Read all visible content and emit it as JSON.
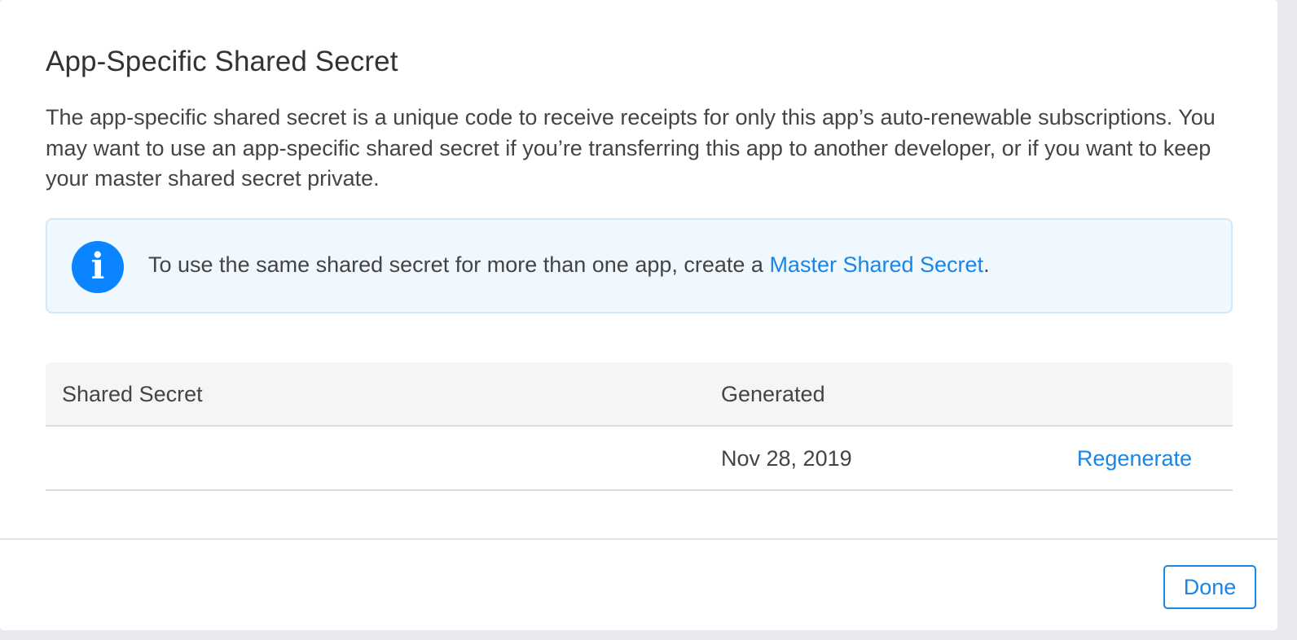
{
  "dialog": {
    "title": "App-Specific Shared Secret",
    "description": "The app-specific shared secret is a unique code to receive receipts for only this app’s auto-renewable subscriptions. You may want to use an app-specific shared secret if you’re transferring this app to another developer, or if you want to keep your master shared secret private."
  },
  "info": {
    "icon": "info-icon",
    "icon_glyph": "i",
    "text_before": "To use the same shared secret for more than one app, create a ",
    "link_label": "Master Shared Secret",
    "text_after": "."
  },
  "table": {
    "columns": [
      "Shared Secret",
      "Generated"
    ],
    "rows": [
      {
        "shared_secret": "",
        "generated": "Nov 28, 2019",
        "action_label": "Regenerate"
      }
    ]
  },
  "footer": {
    "done_label": "Done"
  },
  "colors": {
    "accent": "#1a85e5",
    "info_icon_bg": "#0a84ff",
    "info_box_bg": "#f0f8ff",
    "info_box_border": "#d3e7f8",
    "table_header_bg": "#f5f5f5"
  }
}
